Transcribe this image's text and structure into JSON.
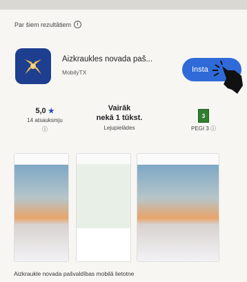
{
  "header": {
    "title": "Par šiem rezultātiem",
    "info_icon": "info-icon"
  },
  "app": {
    "name": "Aizkraukles novada paš...",
    "developer": "MobilyTX",
    "install_label": "Insta",
    "icon": "app-icon",
    "colors": {
      "brand": "#1e3f8f",
      "install": "#2f6ad8"
    }
  },
  "stats": {
    "rating_value": "5,0",
    "rating_star": "★",
    "reviews_label": "14 atsauksmju",
    "downloads_line1": "Vairāk",
    "downloads_line2": "nekā 1 tūkst.",
    "downloads_label": "Lejupielādes",
    "pegi_label": "PEGI 3",
    "pegi_badge_text": "3"
  },
  "screenshots": {
    "caption": "Aizkraukle novada pašvaldības mobilā lietotne"
  }
}
